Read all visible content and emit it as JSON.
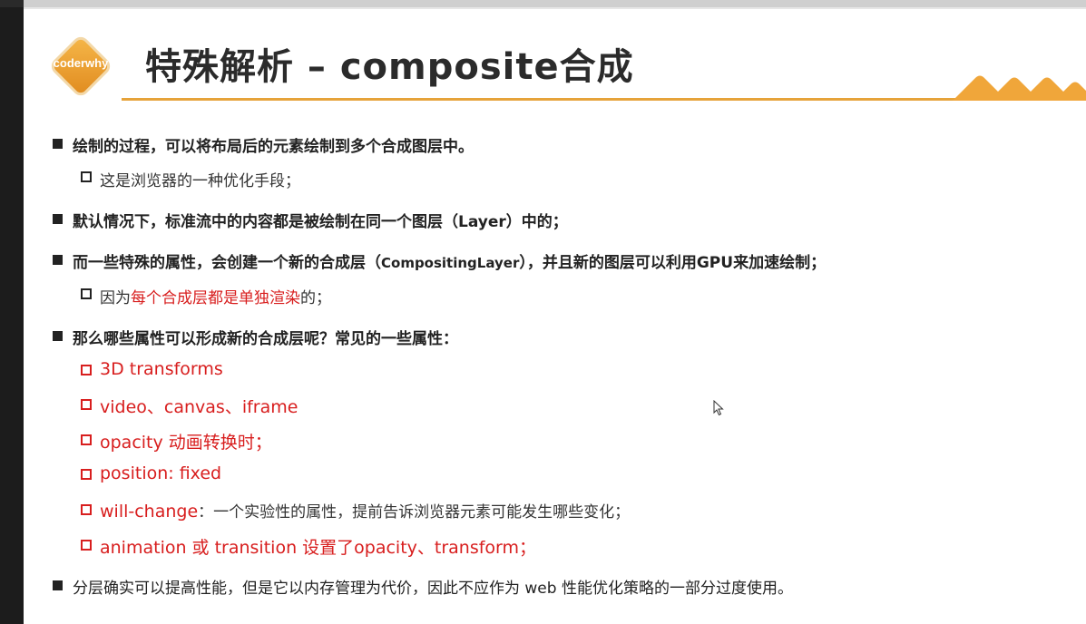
{
  "slide": {
    "logo_text": "coderwhy",
    "title": "特殊解析 – composite合成"
  },
  "bullets": {
    "b1": "绘制的过程，可以将布局后的元素绘制到多个合成图层中。",
    "b1_sub": "这是浏览器的一种优化手段；",
    "b2": "默认情况下，标准流中的内容都是被绘制在同一个图层（Layer）中的；",
    "b3_part1": "而一些特殊的属性，会创建一个新的合成层（",
    "b3_en": "CompositingLayer",
    "b3_part2": "），并且新的图层可以利用GPU来加速绘制；",
    "b3_sub_pre": "因为",
    "b3_sub_red": "每个合成层都是单独渲染",
    "b3_sub_post": "的；",
    "b4": "那么哪些属性可以形成新的合成层呢？常见的一些属性：",
    "props": [
      "3D transforms",
      "video、canvas、iframe",
      "opacity 动画转换时；",
      "position: fixed"
    ],
    "will_change_red": "will-change",
    "will_change_dark": "：一个实验性的属性，提前告诉浏览器元素可能发生哪些变化；",
    "animation_line": "animation 或 transition 设置了opacity、transform；",
    "b5": "分层确实可以提高性能，但是它以内存管理为代价，因此不应作为 web 性能优化策略的一部分过度使用。"
  },
  "colors": {
    "accent": "#e6a33a",
    "highlight": "#d81e1e",
    "title": "#2b2b2b"
  }
}
